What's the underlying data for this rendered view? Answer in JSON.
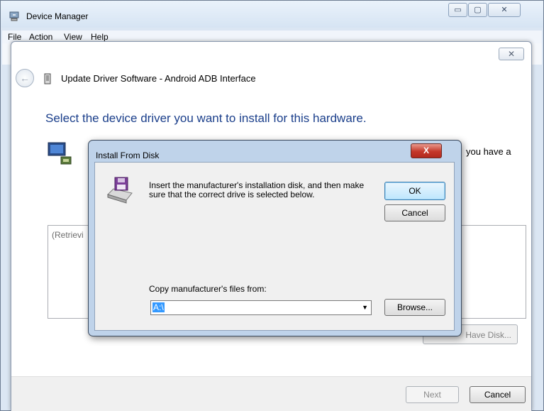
{
  "device_manager": {
    "title": "Device Manager",
    "menu": [
      "File",
      "Action",
      "View",
      "Help"
    ],
    "caption_buttons": {
      "minimize": "▭",
      "maximize": "▢",
      "close": "✕"
    }
  },
  "wizard": {
    "close_glyph": "✕",
    "back_glyph": "←",
    "title": "Update Driver Software - Android ADB Interface",
    "heading": "Select the device driver you want to install for this hardware.",
    "description_tail": "you have a",
    "list_text": "(Retrievi",
    "have_disk_label": "Have Disk...",
    "next_label": "Next",
    "cancel_label": "Cancel"
  },
  "install_from_disk": {
    "title": "Install From Disk",
    "close_glyph": "X",
    "message": "Insert the manufacturer's installation disk, and then make sure that the correct drive is selected below.",
    "ok_label": "OK",
    "cancel_label": "Cancel",
    "copy_label": "Copy manufacturer's files from:",
    "path_value": "A:\\",
    "combo_arrow": "▼",
    "browse_label": "Browse..."
  },
  "colors": {
    "heading_blue": "#1b3f8b",
    "close_red": "#c4382a",
    "selection_blue": "#3399ff",
    "dialog_frame": "#bfd3ea"
  }
}
